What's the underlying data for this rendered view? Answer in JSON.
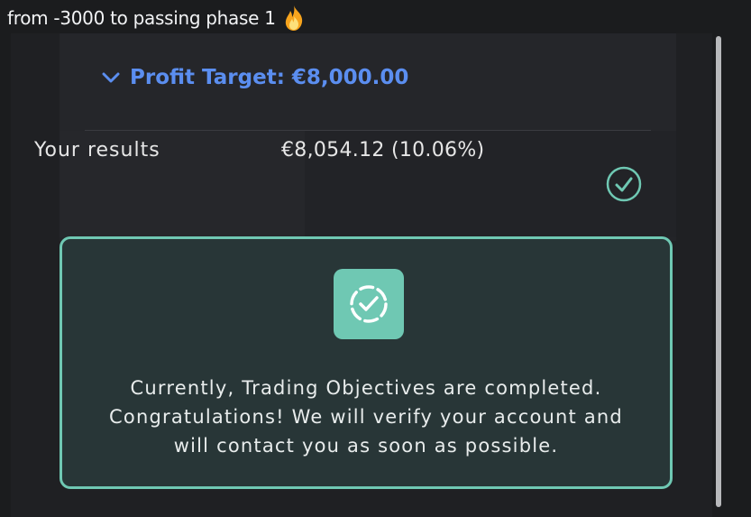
{
  "chat": {
    "message_text": "from -3000 to passing phase 1",
    "emoji_icon": "fire-icon"
  },
  "objective": {
    "title": "Profit Target: €8,000.00",
    "expand_icon": "chevron-down-icon",
    "accent_color": "#5b8ef0"
  },
  "results": {
    "label": "Your results",
    "value": "€8,054.12 (10.06%)",
    "status_icon": "check-circle-icon"
  },
  "notice": {
    "icon": "dashed-check-circle-icon",
    "line1": "Currently, Trading Objectives are completed.",
    "line2": "Congratulations! We will verify your account and",
    "line3": "will contact you as soon as possible.",
    "accent_color": "#6fc8b3"
  }
}
